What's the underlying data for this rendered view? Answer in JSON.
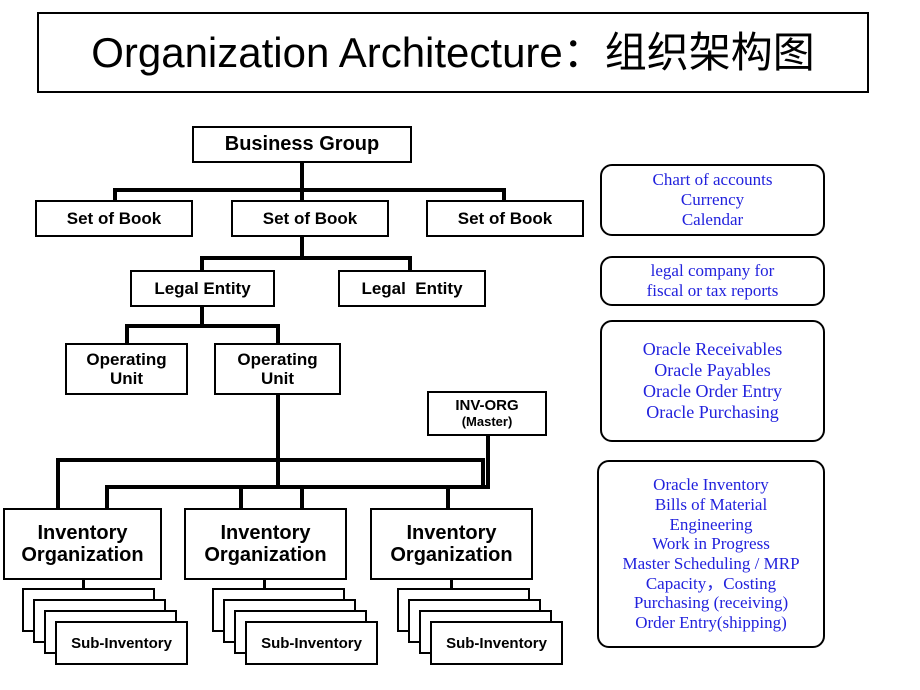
{
  "title": {
    "text": "Organization Architecture：组织架构图"
  },
  "hierarchy": {
    "business_group": "Business Group",
    "sets_of_book": [
      "Set of Book",
      "Set of Book",
      "Set of Book"
    ],
    "legal_entities": [
      "Legal Entity",
      "Legal  Entity"
    ],
    "operating_units": [
      "Operating\nUnit",
      "Operating\nUnit"
    ],
    "operating_unit_lines": [
      [
        "Operating",
        "Unit"
      ],
      [
        "Operating",
        "Unit"
      ]
    ],
    "inv_org_master": {
      "line1": "INV-ORG",
      "line2": "(Master)"
    },
    "inventory_organizations": [
      [
        "Inventory",
        "Organization"
      ],
      [
        "Inventory",
        "Organization"
      ],
      [
        "Inventory",
        "Organization"
      ]
    ],
    "sub_inventories": [
      "Sub-Inventory",
      "Sub-Inventory",
      "Sub-Inventory"
    ],
    "sub_inventory_stack_depth": 4
  },
  "notes": [
    {
      "id": "note-set-of-book",
      "lines": [
        "Chart of accounts",
        "Currency",
        "Calendar"
      ]
    },
    {
      "id": "note-legal-entity",
      "lines": [
        "legal company for",
        "fiscal or tax reports"
      ]
    },
    {
      "id": "note-operating-unit",
      "lines": [
        "Oracle Receivables",
        "Oracle Payables",
        "Oracle Order Entry",
        "Oracle Purchasing"
      ]
    },
    {
      "id": "note-inventory-organization",
      "lines": [
        "Oracle Inventory",
        "Bills of Material",
        "Engineering",
        "Work in Progress",
        "Master Scheduling / MRP",
        "Capacity，Costing",
        "Purchasing (receiving)",
        "Order Entry(shipping)"
      ]
    }
  ],
  "colors": {
    "note_text": "#2222dd",
    "line": "#000000",
    "box_border": "#000000",
    "background": "#ffffff"
  }
}
